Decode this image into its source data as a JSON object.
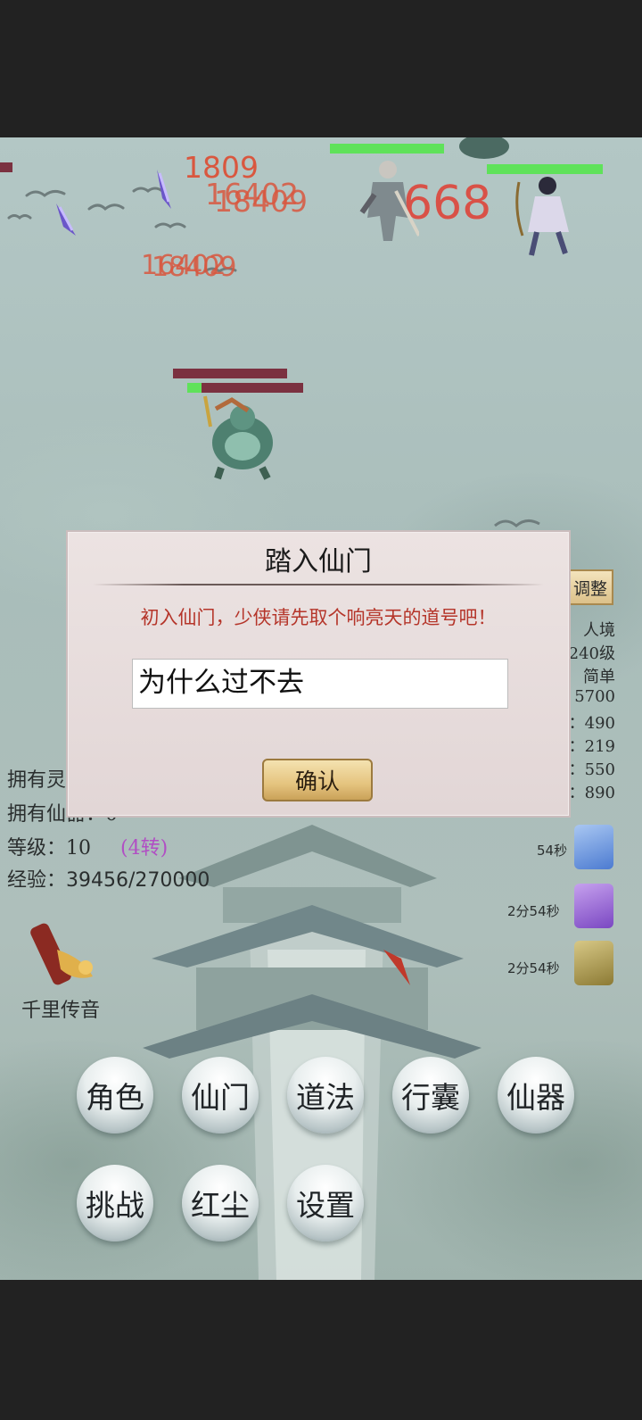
{
  "damage_numbers": [
    "1809",
    "16402",
    "18409",
    "668",
    "16402",
    "18409"
  ],
  "dialog": {
    "title": "踏入仙门",
    "message": "初入仙门，少侠请先取个响亮天的道号吧！",
    "input_value": "为什么过不去",
    "confirm_label": "确认"
  },
  "adjust_label": "调整",
  "right_stats": [
    "人境",
    "240级",
    "简单",
    "5700",
    "：490",
    "：219",
    "：550",
    "：890"
  ],
  "left_stats": {
    "own_1": "拥有灵",
    "own_2": "拥有仙器：0",
    "level_label": "等级：",
    "level_value": "10",
    "rebirth": "(4转)",
    "exp_label": "经验：",
    "exp_value": "39456/270000"
  },
  "timers": [
    "54秒",
    "2分54秒",
    "2分54秒"
  ],
  "scroll_label": "千里传音",
  "menu_buttons": [
    "角色",
    "仙门",
    "道法",
    "行囊",
    "仙器",
    "挑战",
    "红尘",
    "设置"
  ],
  "colors": {
    "accent_red": "#b5352a",
    "hp_green": "#5fe25a",
    "damage": "#d9573f"
  }
}
